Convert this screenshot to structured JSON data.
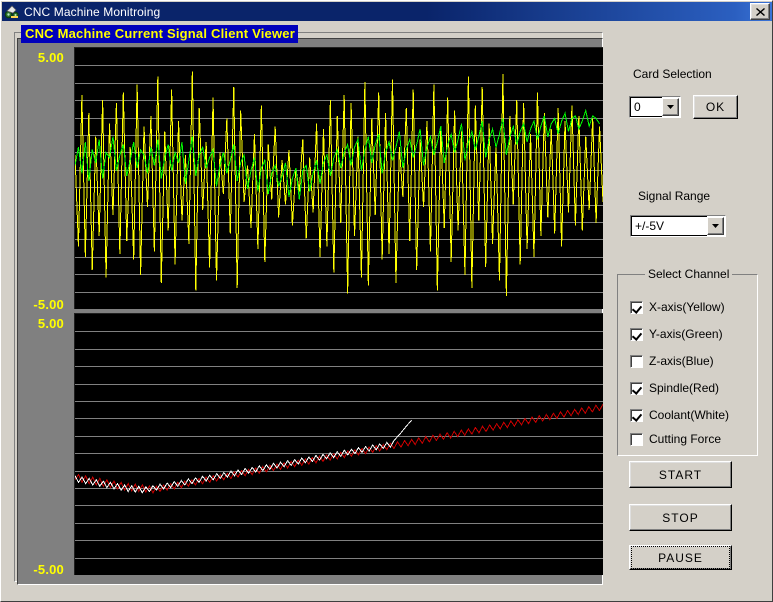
{
  "window": {
    "title": "CNC Machine Monitroing",
    "icon": "cnc-app-icon",
    "close_label": "×"
  },
  "banner": {
    "text": "CNC Machine Current Signal Client Viewer",
    "bg_color": "#0000bb",
    "text_color": "#ffff00"
  },
  "graphs": {
    "top": {
      "max_label": "5.00",
      "min_label": "-5.00"
    },
    "bottom": {
      "max_label": "5.00",
      "min_label": "-5.00"
    }
  },
  "card_selection": {
    "label": "Card Selection",
    "value": "0",
    "options": [
      "0"
    ],
    "ok_label": "OK"
  },
  "signal_range": {
    "label": "Signal Range",
    "value": "+/-5V",
    "options": [
      "+/-5V"
    ]
  },
  "select_channel": {
    "title": "Select Channel",
    "items": [
      {
        "label": "X-axis(Yellow)",
        "checked": true,
        "color": "#ffff00"
      },
      {
        "label": "Y-axis(Green)",
        "checked": true,
        "color": "#00ff00"
      },
      {
        "label": "Z-axis(Blue)",
        "checked": false,
        "color": "#0000ff"
      },
      {
        "label": "Spindle(Red)",
        "checked": true,
        "color": "#ff0000"
      },
      {
        "label": "Coolant(White)",
        "checked": true,
        "color": "#ffffff"
      },
      {
        "label": "Cutting Force",
        "checked": false,
        "color": "#808080"
      }
    ]
  },
  "actions": {
    "start_label": "START",
    "stop_label": "STOP",
    "pause_label": "PAUSE",
    "focused": "PAUSE"
  },
  "chart_data": [
    {
      "type": "line",
      "title": "Top signal plot",
      "ylim": [
        -5.0,
        5.0
      ],
      "ylabel": "",
      "xlabel": "",
      "grid": true,
      "gridlines": 15,
      "background": "#000000",
      "gridline_color": "#808080",
      "legend": "none",
      "series": [
        {
          "name": "X-axis(Yellow)",
          "color": "#ffff00",
          "values": [
            0.9,
            -2.6,
            3.2,
            -3.0,
            2.5,
            -3.5,
            1.6,
            -2.2,
            3.0,
            -3.8,
            2.1,
            -1.4,
            2.9,
            -2.9,
            3.3,
            -2.4,
            1.2,
            -3.1,
            3.6,
            -3.7,
            2.0,
            -1.1,
            2.4,
            -2.8,
            3.9,
            -4.0,
            1.8,
            -2.0,
            3.4,
            -3.3,
            2.2,
            -1.6,
            0.9,
            -2.5,
            4.1,
            -4.3,
            2.7,
            -1.2,
            1.4,
            -3.4,
            3.1,
            -3.9,
            1.0,
            -0.6,
            2.3,
            -2.1,
            3.5,
            -4.2,
            2.6,
            -0.9,
            0.5,
            -1.9,
            1.7,
            -2.7,
            2.8,
            -3.2,
            1.3,
            -0.8,
            2.0,
            -1.5,
            0.7,
            -1.0,
            1.1,
            -1.8,
            0.4,
            -0.5,
            1.5,
            -2.3,
            0.8,
            -1.3,
            2.1,
            -3.0,
            1.9,
            -2.6,
            3.0,
            -3.6,
            2.4,
            -1.7,
            3.2,
            -4.4,
            2.9,
            -2.2,
            1.6,
            -3.8,
            3.7,
            -4.1,
            2.3,
            -1.4,
            3.3,
            -3.1,
            2.5,
            -2.9,
            3.8,
            -4.0,
            1.2,
            -0.7,
            2.7,
            -2.4,
            3.4,
            -3.5,
            1.5,
            -1.1,
            2.2,
            -2.8,
            3.6,
            -4.3,
            2.0,
            -1.9,
            3.1,
            -3.2,
            2.6,
            -2.0,
            1.8,
            -3.7,
            3.9,
            -4.2,
            2.8,
            -1.6,
            3.5,
            -3.4,
            2.1,
            -2.5,
            1.3,
            -3.9,
            4.0,
            -4.5,
            2.4,
            -1.0,
            3.0,
            -3.3,
            2.9,
            -2.7,
            1.7,
            -3.0,
            3.3,
            -2.2,
            2.5,
            -1.5,
            1.9,
            -2.1,
            2.7,
            -2.6,
            2.2,
            -1.3,
            2.8,
            -1.8,
            2.4,
            -2.0,
            1.6,
            -1.2,
            2.3,
            -1.7,
            2.0,
            -0.9
          ]
        },
        {
          "name": "Y-axis(Green)",
          "color": "#00ff00",
          "values": [
            0.5,
            1.2,
            0.2,
            1.4,
            -0.1,
            1.1,
            0.6,
            1.5,
            0.0,
            1.0,
            0.8,
            1.6,
            0.3,
            0.9,
            1.3,
            0.1,
            0.7,
            1.4,
            0.4,
            1.1,
            0.9,
            0.2,
            1.2,
            0.5,
            1.5,
            0.0,
            0.8,
            1.3,
            0.3,
            1.0,
            0.6,
            1.4,
            -0.2,
            0.7,
            1.6,
            0.1,
            0.9,
            1.2,
            0.4,
            0.8,
            1.1,
            -0.3,
            0.5,
            1.0,
            0.2,
            0.7,
            1.3,
            -0.1,
            0.6,
            0.9,
            -0.4,
            0.3,
            0.8,
            -0.5,
            0.4,
            0.7,
            -0.6,
            0.2,
            0.5,
            -0.3,
            0.1,
            0.6,
            -0.7,
            0.0,
            0.4,
            -0.8,
            0.3,
            0.5,
            -0.5,
            0.2,
            0.7,
            -0.2,
            0.6,
            0.9,
            0.1,
            0.8,
            1.1,
            0.4,
            1.0,
            1.3,
            0.5,
            1.2,
            1.5,
            0.3,
            1.1,
            1.6,
            0.6,
            1.3,
            1.7,
            0.2,
            1.0,
            1.4,
            0.7,
            1.2,
            1.8,
            0.4,
            1.1,
            1.5,
            0.8,
            1.3,
            1.9,
            0.5,
            1.2,
            1.6,
            0.9,
            1.4,
            2.0,
            0.6,
            1.3,
            1.7,
            1.0,
            1.5,
            2.1,
            0.7,
            1.4,
            1.8,
            1.1,
            1.6,
            2.2,
            0.8,
            1.5,
            1.9,
            1.2,
            1.7,
            2.3,
            0.9,
            1.6,
            2.0,
            1.3,
            1.8,
            2.1,
            1.4,
            1.9,
            2.2,
            1.5,
            2.0,
            2.4,
            1.6,
            2.1,
            2.3,
            1.7,
            2.2,
            2.5,
            1.8,
            2.3,
            2.4,
            1.9,
            2.2,
            2.6,
            2.0,
            2.4,
            2.3,
            2.1
          ]
        }
      ]
    },
    {
      "type": "line",
      "title": "Bottom signal plot",
      "ylim": [
        -5.0,
        5.0
      ],
      "ylabel": "",
      "xlabel": "",
      "grid": true,
      "gridlines": 15,
      "background": "#000000",
      "gridline_color": "#808080",
      "legend": "none",
      "series": [
        {
          "name": "Spindle(Red)",
          "color": "#cc0000",
          "values": [
            -1.35,
            -1.15,
            -1.45,
            -1.2,
            -1.5,
            -1.25,
            -1.55,
            -1.3,
            -1.6,
            -1.35,
            -1.65,
            -1.4,
            -1.7,
            -1.45,
            -1.75,
            -1.5,
            -1.78,
            -1.52,
            -1.8,
            -1.55,
            -1.82,
            -1.58,
            -1.85,
            -1.6,
            -1.8,
            -1.55,
            -1.75,
            -1.5,
            -1.7,
            -1.45,
            -1.65,
            -1.4,
            -1.6,
            -1.35,
            -1.55,
            -1.3,
            -1.5,
            -1.25,
            -1.45,
            -1.2,
            -1.4,
            -1.15,
            -1.35,
            -1.1,
            -1.3,
            -1.05,
            -1.25,
            -1.0,
            -1.2,
            -0.95,
            -1.15,
            -0.9,
            -1.1,
            -0.85,
            -1.05,
            -0.8,
            -1.0,
            -0.75,
            -0.95,
            -0.7,
            -0.9,
            -0.65,
            -0.85,
            -0.6,
            -0.8,
            -0.55,
            -0.75,
            -0.5,
            -0.7,
            -0.45,
            -0.65,
            -0.4,
            -0.6,
            -0.35,
            -0.55,
            -0.3,
            -0.5,
            -0.25,
            -0.45,
            -0.2,
            -0.4,
            -0.15,
            -0.35,
            -0.1,
            -0.3,
            -0.05,
            -0.25,
            0.0,
            -0.2,
            0.05,
            -0.15,
            0.1,
            -0.1,
            0.15,
            -0.05,
            0.2,
            0.0,
            0.25,
            0.05,
            0.3,
            0.1,
            0.35,
            0.15,
            0.4,
            0.2,
            0.45,
            0.25,
            0.5,
            0.3,
            0.55,
            0.35,
            0.6,
            0.4,
            0.65,
            0.45,
            0.7,
            0.5,
            0.75,
            0.55,
            0.8,
            0.6,
            0.85,
            0.65,
            0.9,
            0.7,
            0.95,
            0.75,
            1.0,
            0.8,
            1.05,
            0.85,
            1.1,
            0.9,
            1.15,
            0.95,
            1.2,
            1.0,
            1.25,
            1.05,
            1.3,
            1.1,
            1.35,
            1.15,
            1.4,
            1.2,
            1.45,
            1.25,
            1.5,
            1.3,
            1.55
          ]
        },
        {
          "name": "Coolant(White)",
          "color": "#ffffff",
          "values": [
            -1.2,
            -1.45,
            -1.25,
            -1.5,
            -1.3,
            -1.55,
            -1.35,
            -1.6,
            -1.4,
            -1.65,
            -1.45,
            -1.7,
            -1.5,
            -1.75,
            -1.55,
            -1.8,
            -1.58,
            -1.82,
            -1.6,
            -1.85,
            -1.62,
            -1.8,
            -1.58,
            -1.75,
            -1.52,
            -1.7,
            -1.48,
            -1.65,
            -1.42,
            -1.6,
            -1.38,
            -1.55,
            -1.32,
            -1.5,
            -1.28,
            -1.45,
            -1.22,
            -1.4,
            -1.18,
            -1.35,
            -1.12,
            -1.3,
            -1.08,
            -1.25,
            -1.02,
            -1.2,
            -0.98,
            -1.15,
            -0.92,
            -1.1,
            -0.88,
            -1.05,
            -0.82,
            -1.0,
            -0.78,
            -0.95,
            -0.72,
            -0.9,
            -0.68,
            -0.85,
            -0.62,
            -0.8,
            -0.58,
            -0.75,
            -0.52,
            -0.7,
            -0.48,
            -0.65,
            -0.42,
            -0.6,
            -0.38,
            -0.55,
            -0.32,
            -0.5,
            -0.28,
            -0.45,
            -0.22,
            -0.4,
            -0.18,
            -0.35,
            -0.12,
            -0.3,
            -0.08,
            -0.25,
            -0.02,
            -0.2,
            0.02,
            -0.15,
            0.08,
            -0.1,
            0.15,
            0.3,
            0.45,
            0.62,
            0.78,
            0.92
          ]
        }
      ]
    }
  ]
}
